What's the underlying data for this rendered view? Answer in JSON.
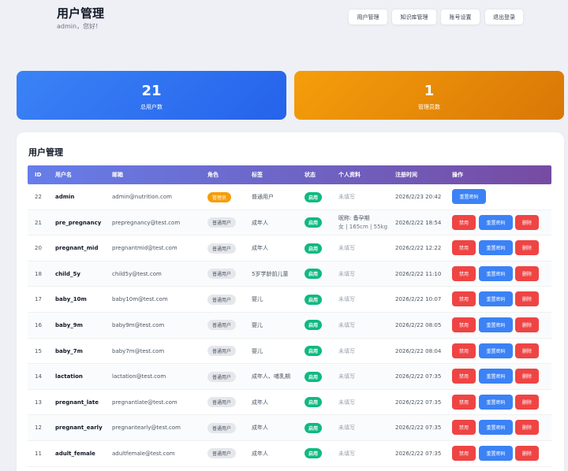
{
  "header": {
    "title": "用户管理",
    "subtitle": "admin，您好!",
    "nav": [
      "用户管理",
      "知识库管理",
      "账号设置",
      "退出登录"
    ]
  },
  "stats": {
    "total_users": "21",
    "total_users_label": "总用户数",
    "admins": "1",
    "admins_label": "管理员数"
  },
  "panel": {
    "title": "用户管理"
  },
  "table": {
    "columns": [
      "ID",
      "用户名",
      "邮箱",
      "角色",
      "标签",
      "状态",
      "个人资料",
      "注册时间",
      "操作"
    ],
    "rows": [
      {
        "id": "22",
        "username": "admin",
        "email": "admin@nutrition.com",
        "role": "管理员",
        "tag": "普通用户",
        "status": "启用",
        "profile": "未填写",
        "profile2": "",
        "date": "2026/2/23 20:42",
        "actions": [
          "重置密码"
        ]
      },
      {
        "id": "21",
        "username": "pre_pregnancy",
        "email": "prepregnancy@test.com",
        "role": "普通用户",
        "tag": "成年人",
        "status": "启用",
        "profile": "昵称: 备孕期",
        "profile2": "女 | 165cm | 55kg",
        "date": "2026/2/22 18:54",
        "actions": [
          "禁用",
          "重置密码",
          "删除"
        ]
      },
      {
        "id": "20",
        "username": "pregnant_mid",
        "email": "pregnantmid@test.com",
        "role": "普通用户",
        "tag": "成年人",
        "status": "启用",
        "profile": "未填写",
        "profile2": "",
        "date": "2026/2/22 12:22",
        "actions": [
          "禁用",
          "重置密码",
          "删除"
        ]
      },
      {
        "id": "18",
        "username": "child_5y",
        "email": "child5y@test.com",
        "role": "普通用户",
        "tag": "5岁学龄前儿童",
        "status": "启用",
        "profile": "未填写",
        "profile2": "",
        "date": "2026/2/22 11:10",
        "actions": [
          "禁用",
          "重置密码",
          "删除"
        ]
      },
      {
        "id": "17",
        "username": "baby_10m",
        "email": "baby10m@test.com",
        "role": "普通用户",
        "tag": "婴儿",
        "status": "启用",
        "profile": "未填写",
        "profile2": "",
        "date": "2026/2/22 10:07",
        "actions": [
          "禁用",
          "重置密码",
          "删除"
        ]
      },
      {
        "id": "16",
        "username": "baby_9m",
        "email": "baby9m@test.com",
        "role": "普通用户",
        "tag": "婴儿",
        "status": "启用",
        "profile": "未填写",
        "profile2": "",
        "date": "2026/2/22 08:05",
        "actions": [
          "禁用",
          "重置密码",
          "删除"
        ]
      },
      {
        "id": "15",
        "username": "baby_7m",
        "email": "baby7m@test.com",
        "role": "普通用户",
        "tag": "婴儿",
        "status": "启用",
        "profile": "未填写",
        "profile2": "",
        "date": "2026/2/22 08:04",
        "actions": [
          "禁用",
          "重置密码",
          "删除"
        ]
      },
      {
        "id": "14",
        "username": "lactation",
        "email": "lactation@test.com",
        "role": "普通用户",
        "tag": "成年人、哺乳期",
        "status": "启用",
        "profile": "未填写",
        "profile2": "",
        "date": "2026/2/22 07:35",
        "actions": [
          "禁用",
          "重置密码",
          "删除"
        ]
      },
      {
        "id": "13",
        "username": "pregnant_late",
        "email": "pregnantlate@test.com",
        "role": "普通用户",
        "tag": "成年人",
        "status": "启用",
        "profile": "未填写",
        "profile2": "",
        "date": "2026/2/22 07:35",
        "actions": [
          "禁用",
          "重置密码",
          "删除"
        ]
      },
      {
        "id": "12",
        "username": "pregnant_early",
        "email": "pregnantearly@test.com",
        "role": "普通用户",
        "tag": "成年人",
        "status": "启用",
        "profile": "未填写",
        "profile2": "",
        "date": "2026/2/22 07:35",
        "actions": [
          "禁用",
          "重置密码",
          "删除"
        ]
      },
      {
        "id": "11",
        "username": "adult_female",
        "email": "adultfemale@test.com",
        "role": "普通用户",
        "tag": "成年人",
        "status": "启用",
        "profile": "未填写",
        "profile2": "",
        "date": "2026/2/22 07:35",
        "actions": [
          "禁用",
          "重置密码",
          "删除"
        ]
      }
    ]
  }
}
